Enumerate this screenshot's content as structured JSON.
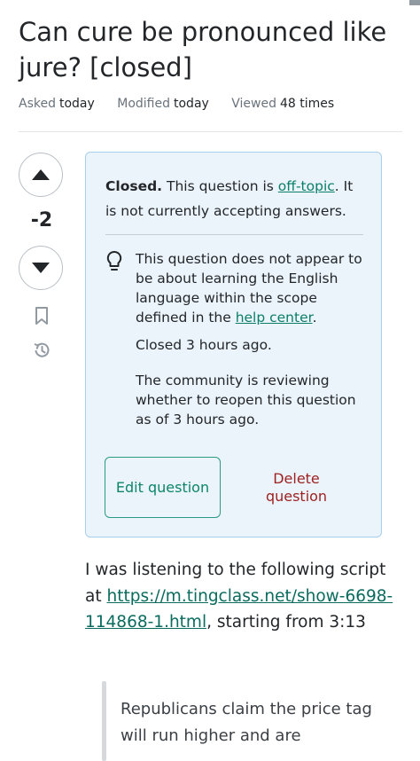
{
  "question": {
    "title": "Can cure be pronounced like jure? [closed]",
    "meta": {
      "asked_label": "Asked",
      "asked_value": "today",
      "modified_label": "Modified",
      "modified_value": "today",
      "viewed_label": "Viewed",
      "viewed_value": "48 times"
    },
    "vote_count": "-2"
  },
  "icons": {
    "upvote": "triangle-up-icon",
    "downvote": "triangle-down-icon",
    "bookmark": "bookmark-icon",
    "history": "history-icon",
    "bulb": "lightbulb-icon"
  },
  "notice": {
    "closed_label": "Closed.",
    "closed_text_1": " This question is ",
    "off_topic_link": "off-topic",
    "closed_text_2": ". It is not currently accepting answers.",
    "reason_text": "This question does not appear to be about learning the English language within the scope defined in the ",
    "help_center_link": "help center",
    "reason_end": ".",
    "closed_when": "Closed 3 hours ago.",
    "review_text": "The community is reviewing whether to reopen this question as of 3 hours ago.",
    "edit_button": "Edit question",
    "delete_button": "Delete question"
  },
  "body": {
    "intro": "I was listening to the following script at ",
    "link": "https://m.tingclass.net/show-6698-114868-1.html",
    "after_link": ", starting from 3:13",
    "quote": "Republicans claim the price tag will run higher and are"
  },
  "colors": {
    "notice_bg": "#ebf4fb",
    "notice_border": "#a6ceed",
    "link_green": "#0a7e68",
    "delete_red": "#9e1f1f"
  }
}
